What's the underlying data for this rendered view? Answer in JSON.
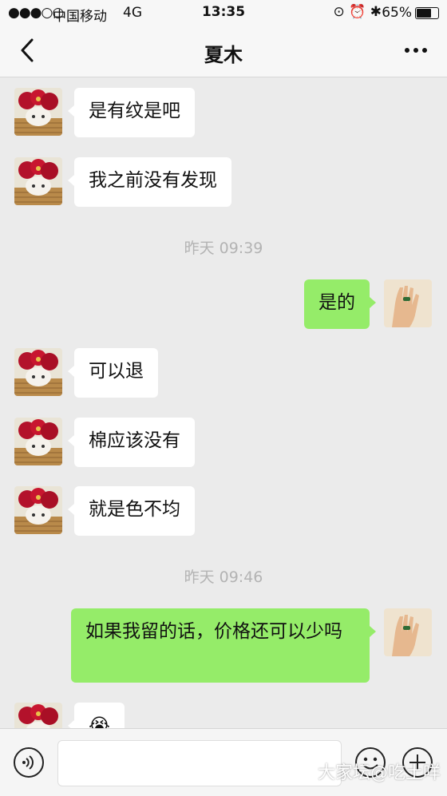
{
  "status_bar": {
    "signal": "●●●○○",
    "carrier": "中国移动",
    "network": "4G",
    "time": "13:35",
    "battery_percent": "65%",
    "battery_level": 0.65
  },
  "nav": {
    "title": "夏木",
    "back_icon": "chevron-left-icon",
    "more_icon": "more-dots-icon"
  },
  "messages": [
    {
      "from": "contact",
      "text": "是有纹是吧"
    },
    {
      "from": "contact",
      "text": "我之前没有发现"
    },
    {
      "timestamp": "昨天 09:39"
    },
    {
      "from": "me",
      "text": "是的"
    },
    {
      "from": "contact",
      "text": "可以退"
    },
    {
      "from": "contact",
      "text": "棉应该没有"
    },
    {
      "from": "contact",
      "text": "就是色不均"
    },
    {
      "timestamp": "昨天 09:46"
    },
    {
      "from": "me",
      "text": "如果我留的话，价格还可以少吗"
    },
    {
      "from": "contact",
      "text": "😭"
    }
  ],
  "input_bar": {
    "voice_icon": "voice-icon",
    "emoji_icon": "smiley-icon",
    "plus_icon": "plus-circle-icon",
    "input_value": ""
  },
  "watermark": "大家坛@吃土咩",
  "colors": {
    "outgoing": "#95ec69",
    "incoming": "#ffffff",
    "background": "#ebebeb"
  }
}
